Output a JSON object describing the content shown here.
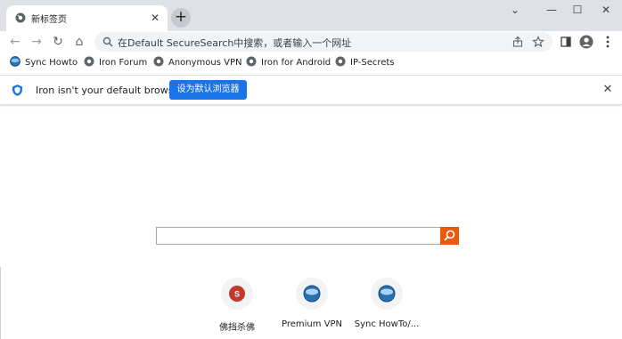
{
  "tab": {
    "title": "新标签页",
    "close": "✕",
    "new_tab": "+"
  },
  "window_controls": {
    "collapse": "⌄",
    "minimize": "—",
    "maximize": "☐",
    "close": "✕"
  },
  "nav": {
    "back": "←",
    "forward": "→",
    "reload": "↻",
    "home": "⌂"
  },
  "omnibox": {
    "text": "在Default SecureSearch中搜索，或者输入一个网址"
  },
  "bookmarks": [
    {
      "label": "Sync Howto",
      "icon": "iron-globe-icon"
    },
    {
      "label": "Iron Forum",
      "icon": "globe-icon"
    },
    {
      "label": "Anonymous VPN",
      "icon": "globe-icon"
    },
    {
      "label": "Iron for Android",
      "icon": "globe-icon"
    },
    {
      "label": "IP-Secrets",
      "icon": "globe-icon"
    }
  ],
  "infobar": {
    "message": "Iron isn't your default browser",
    "button": "设为默认浏览器",
    "close": "✕"
  },
  "shortcuts": [
    {
      "label": "佛挡杀佛",
      "letter": "S",
      "color": "#c0392b"
    },
    {
      "label": "Premium VPN",
      "icon": "iron-globe-icon"
    },
    {
      "label": "Sync HowTo/...",
      "icon": "iron-globe-icon"
    }
  ],
  "colors": {
    "accent": "#1a73e8",
    "search_button": "#e8590c"
  }
}
